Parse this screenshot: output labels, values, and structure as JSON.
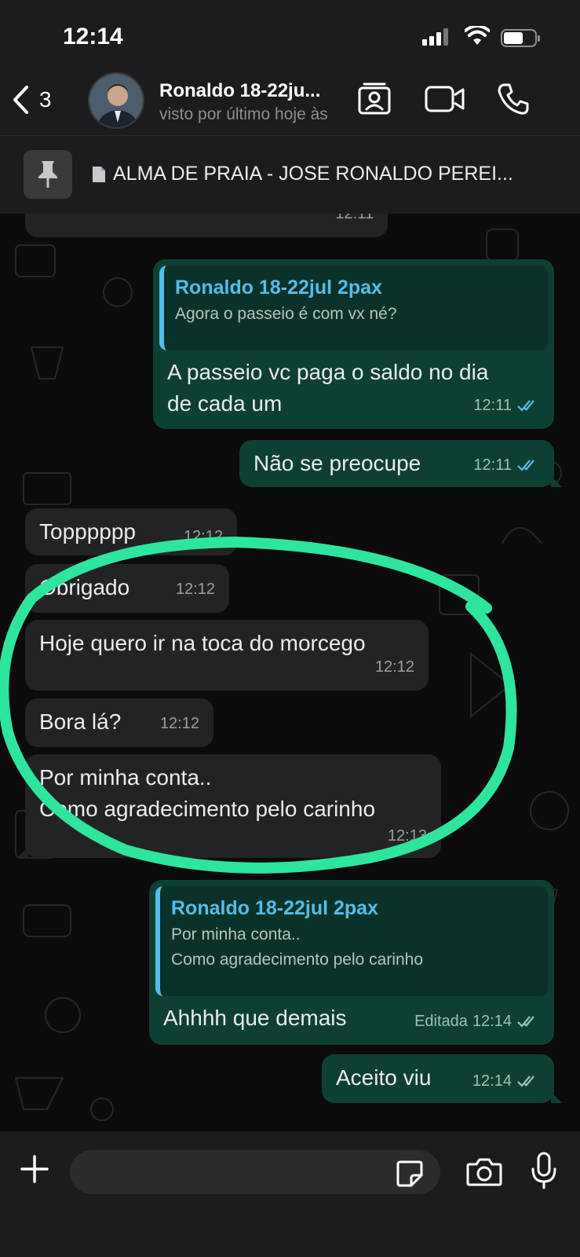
{
  "status_bar": {
    "time": "12:14"
  },
  "header": {
    "back_count": "3",
    "contact_name": "Ronaldo 18-22ju...",
    "last_seen": "visto por último hoje às"
  },
  "pinned": {
    "text": "ALMA DE PRAIA - JOSE RONALDO PEREI..."
  },
  "messages": [
    {
      "dir": "in",
      "time": "12:11"
    },
    {
      "dir": "out",
      "quote_name": "Ronaldo 18-22jul 2pax",
      "quote_text": "Agora o passeio é com vx né?",
      "line1": "A passeio vc paga o saldo no dia",
      "line2": "de cada um",
      "time": "12:11"
    },
    {
      "dir": "out",
      "text": "Não se preocupe",
      "time": "12:11"
    },
    {
      "dir": "in",
      "text": "Topppppp",
      "time": "12:12"
    },
    {
      "dir": "in",
      "text": "Obrigado",
      "time": "12:12"
    },
    {
      "dir": "in",
      "text": "Hoje quero ir na toca do morcego",
      "time": "12:12"
    },
    {
      "dir": "in",
      "text": "Bora lá?",
      "time": "12:12"
    },
    {
      "dir": "in",
      "line1": "Por minha conta..",
      "line2": "Como agradecimento pelo carinho",
      "time": "12:13"
    },
    {
      "dir": "out",
      "quote_name": "Ronaldo 18-22jul 2pax",
      "quote_line1": "Por minha conta..",
      "quote_line2": "Como agradecimento pelo carinho",
      "text": "Ahhhh que demais",
      "edited": "Editada",
      "time": "12:14"
    },
    {
      "dir": "out",
      "text": "Aceito viu",
      "time": "12:14"
    }
  ],
  "input": {
    "placeholder": ""
  },
  "colors": {
    "outgoing": "#0e3f33",
    "incoming": "#222324",
    "highlight": "#2ee59d",
    "quote_accent": "#53bdeb"
  }
}
